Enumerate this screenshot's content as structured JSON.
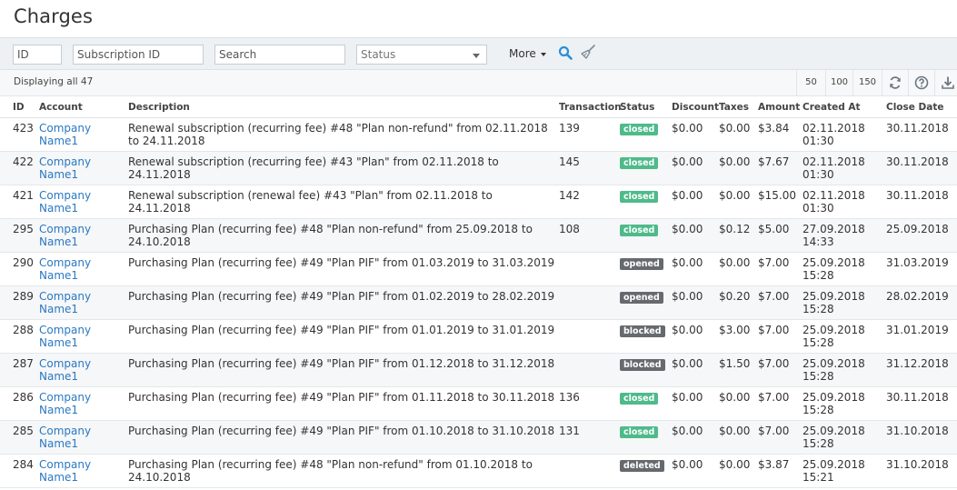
{
  "page": {
    "title": "Charges"
  },
  "filters": {
    "id_placeholder": "ID",
    "subscription_placeholder": "Subscription ID",
    "search_placeholder": "Search",
    "status_placeholder": "Status",
    "more_label": "More"
  },
  "toolbar": {
    "displaying": "Displaying all 47",
    "page_sizes": [
      "50",
      "100",
      "150"
    ]
  },
  "table": {
    "columns": {
      "id": "ID",
      "account": "Account",
      "description": "Description",
      "transaction": "Transaction",
      "status": "Status",
      "discount": "Discount",
      "taxes": "Taxes",
      "amount": "Amount",
      "created_at": "Created At",
      "close_date": "Close Date"
    },
    "rows": [
      {
        "id": "423",
        "account": "Company Name1",
        "description": "Renewal subscription (recurring fee) #48 \"Plan non-refund\" from 02.11.2018 to 24.11.2018",
        "transaction": "139",
        "status": "closed",
        "discount": "$0.00",
        "taxes": "$0.00",
        "amount": "$3.84",
        "created_at": "02.11.2018 01:30",
        "close_date": "30.11.2018"
      },
      {
        "id": "422",
        "account": "Company Name1",
        "description": "Renewal subscription (recurring fee) #43 \"Plan\" from 02.11.2018 to 24.11.2018",
        "transaction": "145",
        "status": "closed",
        "discount": "$0.00",
        "taxes": "$0.00",
        "amount": "$7.67",
        "created_at": "02.11.2018 01:30",
        "close_date": "30.11.2018"
      },
      {
        "id": "421",
        "account": "Company Name1",
        "description": "Renewal subscription (renewal fee) #43 \"Plan\" from 02.11.2018 to 24.11.2018",
        "transaction": "142",
        "status": "closed",
        "discount": "$0.00",
        "taxes": "$0.00",
        "amount": "$15.00",
        "created_at": "02.11.2018 01:30",
        "close_date": "30.11.2018"
      },
      {
        "id": "295",
        "account": "Company Name1",
        "description": "Purchasing Plan (recurring fee) #48 \"Plan non-refund\" from 25.09.2018 to 24.10.2018",
        "transaction": "108",
        "status": "closed",
        "discount": "$0.00",
        "taxes": "$0.12",
        "amount": "$5.00",
        "created_at": "27.09.2018 14:33",
        "close_date": "25.09.2018"
      },
      {
        "id": "290",
        "account": "Company Name1",
        "description": "Purchasing Plan (recurring fee) #49 \"Plan PIF\" from 01.03.2019 to 31.03.2019",
        "transaction": "",
        "status": "opened",
        "discount": "$0.00",
        "taxes": "$0.00",
        "amount": "$7.00",
        "created_at": "25.09.2018 15:28",
        "close_date": "31.03.2019"
      },
      {
        "id": "289",
        "account": "Company Name1",
        "description": "Purchasing Plan (recurring fee) #49 \"Plan PIF\" from 01.02.2019 to 28.02.2019",
        "transaction": "",
        "status": "opened",
        "discount": "$0.00",
        "taxes": "$0.20",
        "amount": "$7.00",
        "created_at": "25.09.2018 15:28",
        "close_date": "28.02.2019"
      },
      {
        "id": "288",
        "account": "Company Name1",
        "description": "Purchasing Plan (recurring fee) #49 \"Plan PIF\" from 01.01.2019 to 31.01.2019",
        "transaction": "",
        "status": "blocked",
        "discount": "$0.00",
        "taxes": "$3.00",
        "amount": "$7.00",
        "created_at": "25.09.2018 15:28",
        "close_date": "31.01.2019"
      },
      {
        "id": "287",
        "account": "Company Name1",
        "description": "Purchasing Plan (recurring fee) #49 \"Plan PIF\" from 01.12.2018 to 31.12.2018",
        "transaction": "",
        "status": "blocked",
        "discount": "$0.00",
        "taxes": "$1.50",
        "amount": "$7.00",
        "created_at": "25.09.2018 15:28",
        "close_date": "31.12.2018"
      },
      {
        "id": "286",
        "account": "Company Name1",
        "description": "Purchasing Plan (recurring fee) #49 \"Plan PIF\" from 01.11.2018 to 30.11.2018",
        "transaction": "136",
        "status": "closed",
        "discount": "$0.00",
        "taxes": "$0.00",
        "amount": "$7.00",
        "created_at": "25.09.2018 15:28",
        "close_date": "30.11.2018"
      },
      {
        "id": "285",
        "account": "Company Name1",
        "description": "Purchasing Plan (recurring fee) #49 \"Plan PIF\" from 01.10.2018 to 31.10.2018",
        "transaction": "131",
        "status": "closed",
        "discount": "$0.00",
        "taxes": "$0.00",
        "amount": "$7.00",
        "created_at": "25.09.2018 15:28",
        "close_date": "31.10.2018"
      },
      {
        "id": "284",
        "account": "Company Name1",
        "description": "Purchasing Plan (recurring fee) #48 \"Plan non-refund\" from 01.10.2018 to 24.10.2018",
        "transaction": "",
        "status": "deleted",
        "discount": "$0.00",
        "taxes": "$0.00",
        "amount": "$3.87",
        "created_at": "25.09.2018 15:21",
        "close_date": "31.10.2018"
      }
    ]
  },
  "icons": {
    "search": "search-icon",
    "clear": "broom-icon",
    "refresh": "refresh-icon",
    "help": "help-icon",
    "export": "download-icon"
  },
  "colors": {
    "link": "#2a78c2",
    "status_closed": "#4fba8a",
    "status_other": "#666a6e",
    "search_icon": "#2a8fd6"
  }
}
